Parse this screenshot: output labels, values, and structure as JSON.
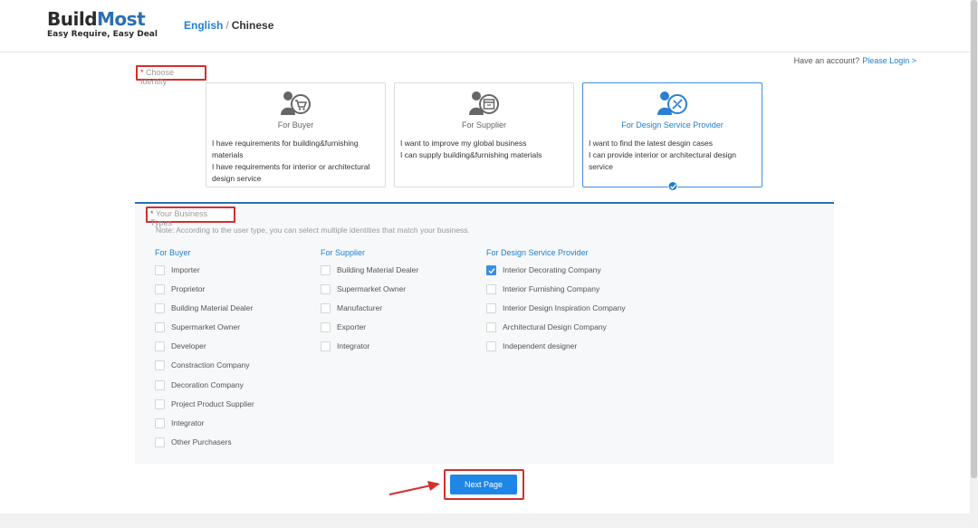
{
  "brand": {
    "name_part1": "Build",
    "name_part2": "Most",
    "tagline": "Easy Require, Easy Deal"
  },
  "language": {
    "english": "English",
    "separator": "/",
    "chinese": "Chinese"
  },
  "account": {
    "prompt": "Have an account?",
    "login_link": "Please Login >"
  },
  "identity_section": {
    "label_star": "*",
    "label": " Choose Identity",
    "cards": [
      {
        "title": "For Buyer",
        "lines": [
          "I have requirements for building&furnishing",
          "materials",
          "I have requirements for interior or architectural",
          "design service"
        ],
        "icon": "buyer-cart-icon",
        "selected": false
      },
      {
        "title": "For Supplier",
        "lines": [
          "I want to improve my global business",
          "I can supply building&furnishing materials",
          "",
          ""
        ],
        "icon": "supplier-shop-icon",
        "selected": false
      },
      {
        "title": "For Design Service Provider",
        "lines": [
          "I want to find the latest desgin cases",
          "I can provide interior or architectural design",
          "service",
          ""
        ],
        "icon": "design-tools-icon",
        "selected": true
      }
    ]
  },
  "business_section": {
    "label_star": "*",
    "label": " Your Business Types",
    "note": "Note: According to the user type, you can select multiple identities that match your business.",
    "columns": [
      {
        "title": "For Buyer",
        "options": [
          {
            "label": "Importer",
            "checked": false
          },
          {
            "label": "Proprietor",
            "checked": false
          },
          {
            "label": "Building Material Dealer",
            "checked": false
          },
          {
            "label": "Supermarket Owner",
            "checked": false
          },
          {
            "label": "Developer",
            "checked": false
          },
          {
            "label": "Constraction Company",
            "checked": false
          },
          {
            "label": "Decoration Company",
            "checked": false
          },
          {
            "label": "Project Product Supplier",
            "checked": false
          },
          {
            "label": "Integrator",
            "checked": false
          },
          {
            "label": "Other Purchasers",
            "checked": false
          }
        ]
      },
      {
        "title": "For Supplier",
        "options": [
          {
            "label": "Building Material Dealer",
            "checked": false
          },
          {
            "label": "Supermarket Owner",
            "checked": false
          },
          {
            "label": "Manufacturer",
            "checked": false
          },
          {
            "label": "Exporter",
            "checked": false
          },
          {
            "label": "Integrator",
            "checked": false
          }
        ]
      },
      {
        "title": "For Design Service Provider",
        "options": [
          {
            "label": "Interior Decorating Company",
            "checked": true
          },
          {
            "label": "Interior Furnishing Company",
            "checked": false
          },
          {
            "label": "Interior Design Inspiration Company",
            "checked": false
          },
          {
            "label": "Architectural Design Company",
            "checked": false
          },
          {
            "label": "Independent designer",
            "checked": false
          }
        ]
      }
    ]
  },
  "actions": {
    "next_label": "Next Page"
  },
  "colors": {
    "accent": "#1e87e6",
    "highlight_box": "#d32f2f",
    "brand_blue": "#2a6fb6"
  }
}
